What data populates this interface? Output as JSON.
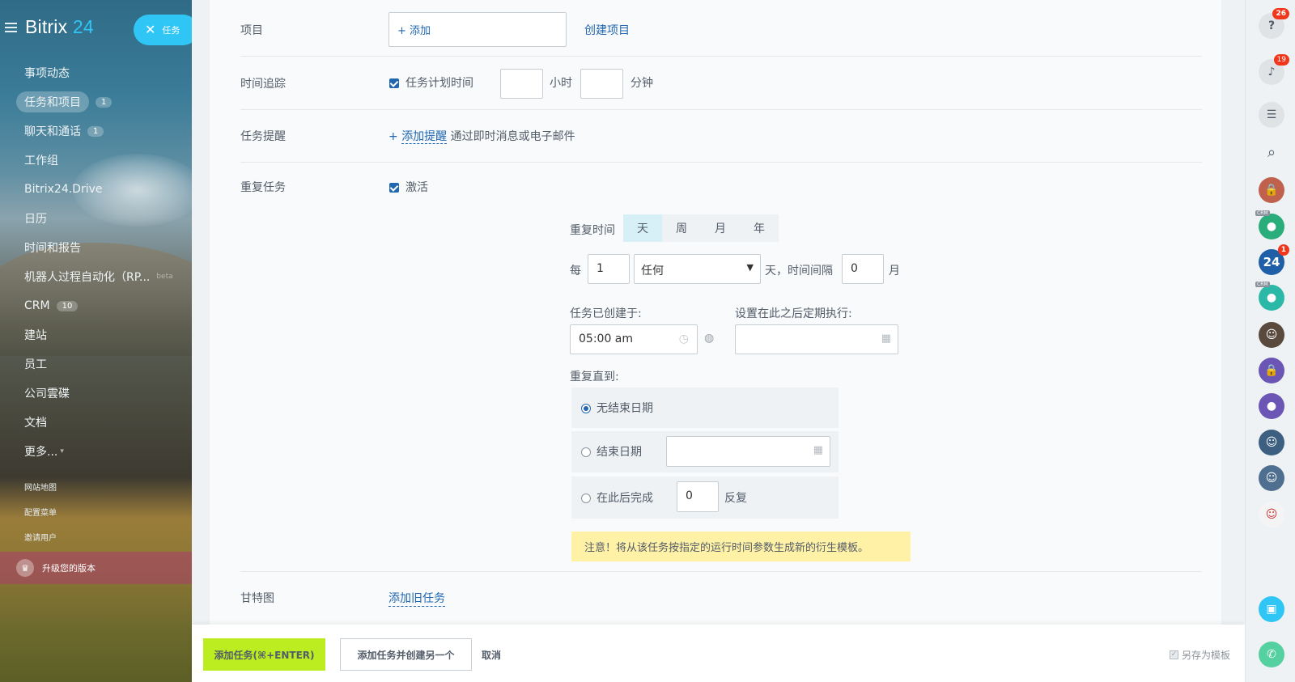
{
  "sidebar": {
    "brand_main": "Bitrix",
    "brand_num": "24",
    "task_pill_label": "任务",
    "items": [
      {
        "label": "事项动态",
        "count": ""
      },
      {
        "label": "任务和项目",
        "count": "1"
      },
      {
        "label": "聊天和通话",
        "count": "1"
      },
      {
        "label": "工作组",
        "count": ""
      },
      {
        "label": "Bitrix24.Drive",
        "count": ""
      },
      {
        "label": "日历",
        "count": ""
      },
      {
        "label": "时间和报告",
        "count": ""
      },
      {
        "label": "机器人过程自动化（RP...",
        "count": "",
        "beta": "beta"
      },
      {
        "label": "CRM",
        "count": "10"
      },
      {
        "label": "建站",
        "count": ""
      },
      {
        "label": "员工",
        "count": ""
      },
      {
        "label": "公司雲碟",
        "count": ""
      },
      {
        "label": "文档",
        "count": ""
      },
      {
        "label": "更多...",
        "count": ""
      }
    ],
    "small_links": [
      "网站地图",
      "配置菜单",
      "邀请用户"
    ],
    "upgrade_label": "升级您的版本"
  },
  "form": {
    "project": {
      "label": "项目",
      "add_label": "+ 添加",
      "create_link": "创建项目"
    },
    "time_tracking": {
      "label": "时间追踪",
      "checkbox_label": "任务计划时间",
      "hours_value": "",
      "hours_unit": "小时",
      "minutes_value": "",
      "minutes_unit": "分钟"
    },
    "reminder": {
      "label": "任务提醒",
      "plus": "+",
      "add_link": "添加提醒",
      "hint": "通过即时消息或电子邮件"
    },
    "repeat": {
      "label": "重复任务",
      "active_label": "激活",
      "period_label": "重复时间",
      "periods": [
        "天",
        "周",
        "月",
        "年"
      ],
      "selected_period": "天",
      "every_label": "每",
      "every_value": "1",
      "any_select": "任何",
      "day_interval_text": "天，时间间隔",
      "interval_value": "0",
      "month_label": "月",
      "created_label": "任务已创建于:",
      "created_time": "05:00 am",
      "start_after_label": "设置在此之后定期执行:",
      "start_after_value": "",
      "until_label": "重复直到:",
      "no_end_label": "无结束日期",
      "end_date_label": "结束日期",
      "end_date_value": "",
      "after_label": "在此后完成",
      "after_value": "0",
      "after_unit": "反复",
      "warning": "注意！将从该任务按指定的运行时间参数生成新的衍生模板。"
    },
    "gantt": {
      "label": "甘特图",
      "add_link": "添加旧任务"
    }
  },
  "footer": {
    "add_task": "添加任务(⌘+ENTER)",
    "add_and_create": "添加任务并创建另一个",
    "cancel": "取消",
    "save_template": "另存为模板"
  },
  "rightbar": {
    "help_badge": "26",
    "notif_badge": "19",
    "b24_badge": "1",
    "b24_label": "24",
    "crm_tag": "CRM"
  },
  "colors": {
    "accent": "#2fc6f6",
    "link": "#2067b0",
    "primary_button": "#bbed21",
    "warning_bg": "#fff1a6",
    "badge": "#f0371b"
  }
}
